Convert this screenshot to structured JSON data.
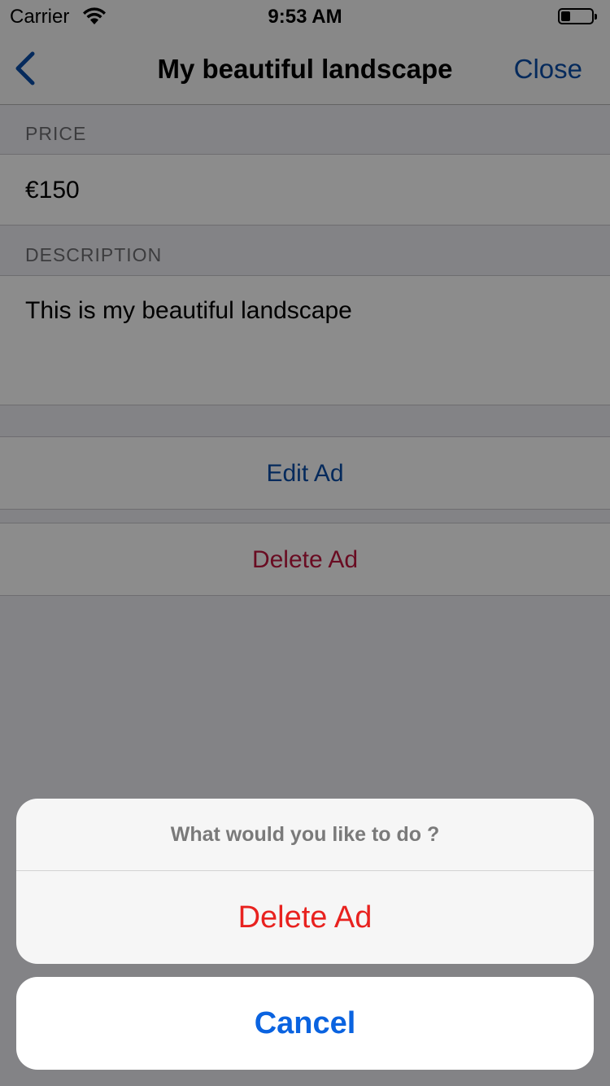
{
  "status_bar": {
    "carrier": "Carrier",
    "time": "9:53 AM",
    "battery_level": 0.3
  },
  "nav": {
    "title": "My beautiful landscape",
    "close_label": "Close",
    "back_icon": "chevron-left-icon"
  },
  "price_section": {
    "header": "PRICE",
    "value": "€150"
  },
  "description_section": {
    "header": "DESCRIPTION",
    "value": "This is my beautiful landscape"
  },
  "actions": {
    "edit_label": "Edit Ad",
    "delete_label": "Delete Ad"
  },
  "action_sheet": {
    "title": "What would you like to do ?",
    "destructive_label": "Delete Ad",
    "cancel_label": "Cancel"
  },
  "colors": {
    "tint": "#0a4ea8",
    "destructive": "#e8221f",
    "cancel": "#0a63e0",
    "delete_cell_text": "#c0163f"
  }
}
